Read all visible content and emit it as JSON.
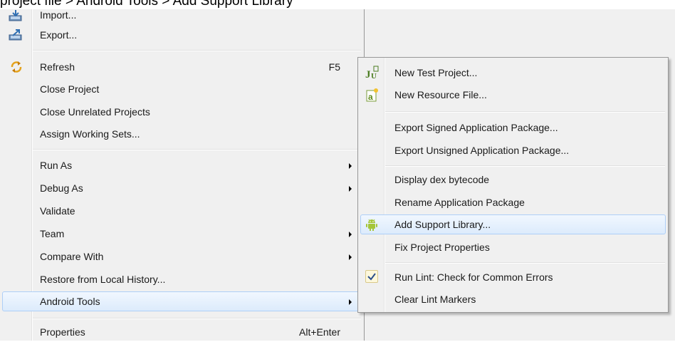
{
  "caption": "project file > Android Tools > Add Support Library",
  "main_menu": {
    "import": "Import...",
    "export": "Export...",
    "refresh": "Refresh",
    "refresh_accel": "F5",
    "close_project": "Close Project",
    "close_unrelated": "Close Unrelated Projects",
    "assign_working_sets": "Assign Working Sets...",
    "run_as": "Run As",
    "debug_as": "Debug As",
    "validate": "Validate",
    "team": "Team",
    "compare_with": "Compare With",
    "restore_history": "Restore from Local History...",
    "android_tools": "Android Tools",
    "properties": "Properties",
    "properties_accel": "Alt+Enter"
  },
  "sub_menu": {
    "new_test_project": "New Test Project...",
    "new_resource_file": "New Resource File...",
    "export_signed": "Export Signed Application Package...",
    "export_unsigned": "Export Unsigned Application Package...",
    "display_dex": "Display dex bytecode",
    "rename_package": "Rename Application Package",
    "add_support_library": "Add Support Library...",
    "fix_properties": "Fix Project Properties",
    "run_lint": "Run Lint: Check for Common Errors",
    "clear_lint": "Clear Lint Markers"
  },
  "icons": {
    "import": "import-icon",
    "export": "export-icon",
    "refresh": "refresh-icon",
    "junit": "junit-icon",
    "resource": "android-resource-icon",
    "android": "android-icon",
    "check": "check-icon"
  },
  "colors": {
    "menu_bg": "#f0f0f0",
    "highlight_border": "#aecff7",
    "android_green": "#a4c639"
  }
}
